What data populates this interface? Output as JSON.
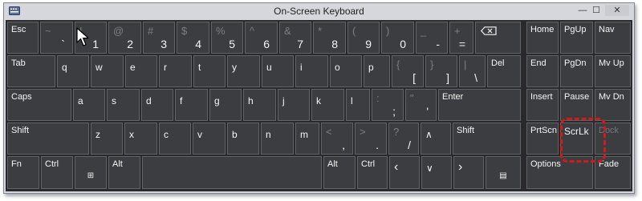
{
  "window": {
    "title": "On-Screen Keyboard",
    "minimize_label": "—",
    "maximize_label": "☐",
    "close_label": "✕"
  },
  "rows": {
    "r1": {
      "esc": "Esc",
      "backtick": {
        "shift": "~",
        "main": "`"
      },
      "k1": {
        "shift": "!",
        "main": "1"
      },
      "k2": {
        "shift": "@",
        "main": "2"
      },
      "k3": {
        "shift": "#",
        "main": "3"
      },
      "k4": {
        "shift": "$",
        "main": "4"
      },
      "k5": {
        "shift": "%",
        "main": "5"
      },
      "k6": {
        "shift": "^",
        "main": "6"
      },
      "k7": {
        "shift": "&",
        "main": "7"
      },
      "k8": {
        "shift": "*",
        "main": "8"
      },
      "k9": {
        "shift": "(",
        "main": "9"
      },
      "k0": {
        "shift": ")",
        "main": "0"
      },
      "minus": {
        "shift": "_",
        "main": "-"
      },
      "equals": {
        "shift": "+",
        "main": "="
      },
      "backspace_icon": "backspace-icon"
    },
    "r2": {
      "tab": "Tab",
      "q": "q",
      "w": "w",
      "e": "e",
      "r": "r",
      "t": "t",
      "y": "y",
      "u": "u",
      "i": "i",
      "o": "o",
      "p": "p",
      "lbracket": {
        "shift": "{",
        "main": "["
      },
      "rbracket": {
        "shift": "}",
        "main": "]"
      },
      "backslash": {
        "shift": "|",
        "main": "\\"
      },
      "del": "Del"
    },
    "r3": {
      "caps": "Caps",
      "a": "a",
      "s": "s",
      "d": "d",
      "f": "f",
      "g": "g",
      "h": "h",
      "j": "j",
      "k": "k",
      "l": "l",
      "semicolon": {
        "shift": ":",
        "main": ";"
      },
      "quote": {
        "shift": "\"",
        "main": "'"
      },
      "enter": "Enter"
    },
    "r4": {
      "shift_left": "Shift",
      "z": "z",
      "x": "x",
      "c": "c",
      "v": "v",
      "b": "b",
      "n": "n",
      "m": "m",
      "comma": {
        "shift": "<",
        "main": ","
      },
      "period": {
        "shift": ">",
        "main": "."
      },
      "slash": {
        "shift": "?",
        "main": "/"
      },
      "up": "∧",
      "shift_right": "Shift"
    },
    "r5": {
      "fn": "Fn",
      "ctrl_left": "Ctrl",
      "win": "⊞",
      "alt_left": "Alt",
      "alt_right": "Alt",
      "ctrl_right": "Ctrl",
      "left": "‹",
      "down": "∨",
      "right": "›",
      "menu": "▤"
    }
  },
  "nav": {
    "home": "Home",
    "pgup": "PgUp",
    "nav": "Nav",
    "end": "End",
    "pgdn": "PgDn",
    "mvup": "Mv Up",
    "insert": "Insert",
    "pause": "Pause",
    "mvdn": "Mv Dn",
    "prtscn": "PrtScn",
    "scrlk": "ScrLk",
    "dock": "Dock",
    "options": "Options",
    "fade": "Fade"
  },
  "colors": {
    "board": "#2a2a2c",
    "key": "#3c3d40",
    "highlight": "#d21a1a"
  }
}
